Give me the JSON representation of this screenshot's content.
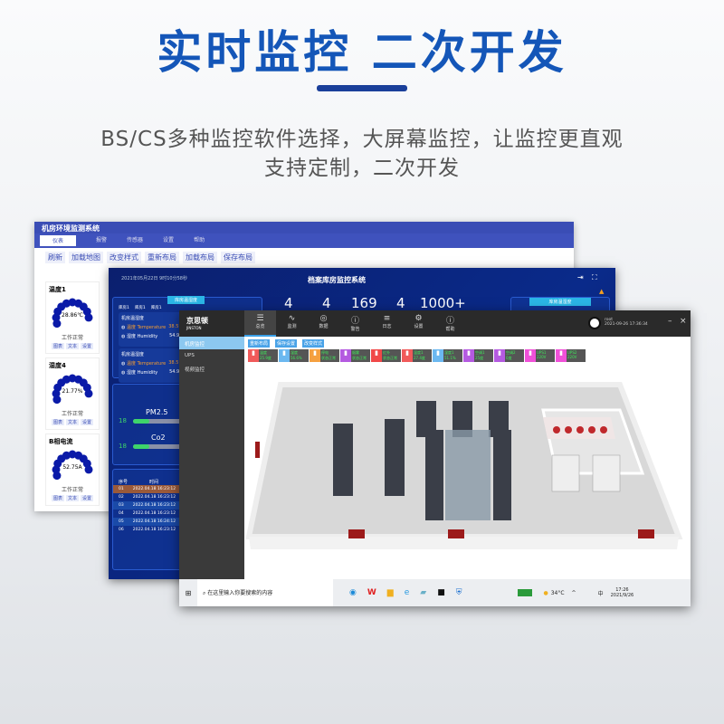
{
  "hero": {
    "title": "实时监控  二次开发",
    "subtitle_line1": "BS/CS多种监控软件选择，大屏幕监控，让监控更直观",
    "subtitle_line2": "支持定制，二次开发"
  },
  "window1": {
    "title": "机房环境监测系统",
    "nav": [
      "仪表",
      "报警",
      "传感器",
      "设置",
      "帮助"
    ],
    "toolbar": [
      "刷新",
      "加载地图",
      "改变样式",
      "重新布局",
      "加载布局",
      "保存布局"
    ],
    "gauges": [
      {
        "name": "温度1",
        "value": "28.86℃",
        "status": "工作正常"
      },
      {
        "name": "湿度4",
        "value": "21.77%",
        "status": "工作正常"
      },
      {
        "name": "B相电流",
        "value": "52.75A",
        "status": "工作正常"
      }
    ],
    "gauge_buttons": [
      "图表",
      "文本",
      "设置"
    ],
    "gauge_color": "#0a1aa8"
  },
  "window2": {
    "date": "2021年05月22日 9时10分58秒",
    "title": "档案库房监控系统",
    "stats": [
      "4",
      "4",
      "169",
      "4",
      "1000+"
    ],
    "panel_temp": "库房温湿度",
    "legend": [
      "库房1",
      "库房1",
      "库房1"
    ],
    "cards": [
      {
        "title": "机房温湿度",
        "temp_label": "温度",
        "temp_en": "Temperature",
        "temp": "38.5℃",
        "hum_label": "湿度",
        "hum_en": "Humidity",
        "hum": "54.9%"
      },
      {
        "title": "机房温湿度",
        "temp_label": "温度",
        "temp_en": "Temperature",
        "temp": "38.5℃",
        "hum_label": "湿度",
        "hum_en": "Humidity",
        "hum": "54.9%"
      }
    ],
    "air": [
      {
        "label": "PM2.5",
        "value": "18"
      },
      {
        "label": "Co2",
        "value": "18"
      }
    ],
    "table_headers": [
      "序号",
      "时间"
    ],
    "rows": [
      [
        "01",
        "2022.04.18 16:23:12"
      ],
      [
        "02",
        "2022.04.18 16:23:12"
      ],
      [
        "03",
        "2022.04.18 16:23:12"
      ],
      [
        "04",
        "2022.04.18 16:23:12"
      ],
      [
        "05",
        "2022.04.18 16:24:12"
      ],
      [
        "06",
        "2022.04.18 16:23:12"
      ]
    ],
    "right_panel": "库房温湿度"
  },
  "window3": {
    "brand": "京思顿",
    "brand_en": "JINSTON",
    "tabs": [
      "总览",
      "监测",
      "数据",
      "警告",
      "日志",
      "设置",
      "帮助"
    ],
    "user": "root",
    "datetime": "2021-09-26 17:36:34",
    "sidebar": [
      "机房监控",
      "UPS",
      "视频监控"
    ],
    "buttons": [
      "重新布局",
      "保存设置",
      "改变样式"
    ],
    "tiles": [
      {
        "name": "温度",
        "value": "25.9度",
        "color": "#f05a5a"
      },
      {
        "name": "湿度",
        "value": "56.6%",
        "color": "#6bb8f0"
      },
      {
        "name": "停电",
        "value": "状态正常",
        "color": "#f5a040"
      },
      {
        "name": "烟雾",
        "value": "状态正常",
        "color": "#b45ae0"
      },
      {
        "name": "红外",
        "value": "状态正常",
        "color": "#f04848"
      },
      {
        "name": "温度1",
        "value": "27.4度",
        "color": "#f05a5a"
      },
      {
        "name": "湿度1",
        "value": "51.1%",
        "color": "#6bb8f0"
      },
      {
        "name": "空调1",
        "value": "25度",
        "color": "#b45ae0"
      },
      {
        "name": "空调2",
        "value": "0度",
        "color": "#b45ae0"
      },
      {
        "name": "UPS1",
        "value": "220V",
        "color": "#f050d8"
      },
      {
        "name": "UPS2",
        "value": "220V",
        "color": "#f050d8"
      }
    ],
    "taskbar": {
      "search_placeholder": "在这里输入你要搜索的内容",
      "weather": "34°C",
      "ime": "中",
      "time": "17:26",
      "date": "2021/9/26"
    }
  }
}
